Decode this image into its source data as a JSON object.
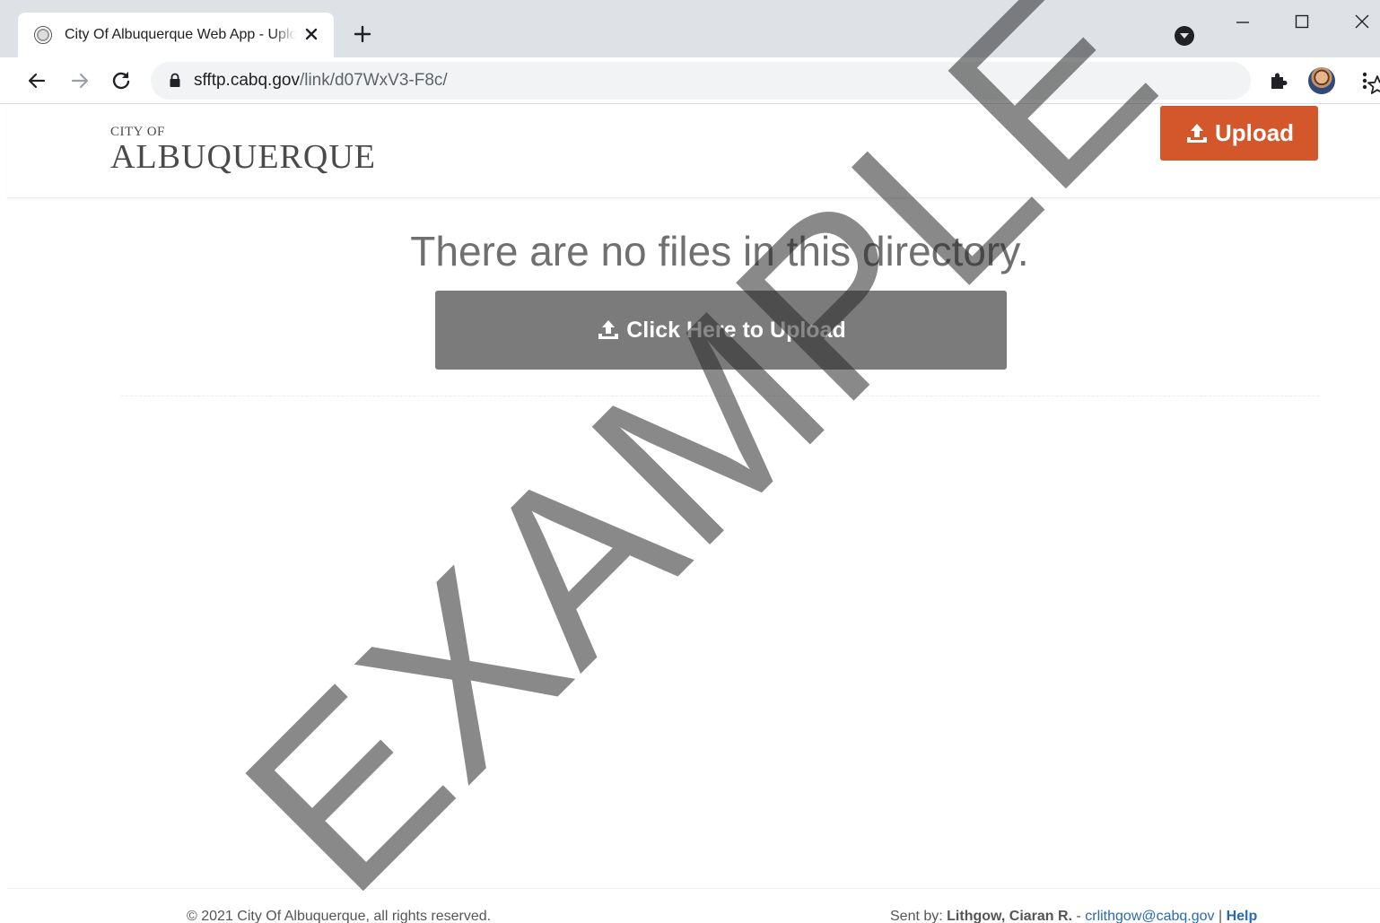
{
  "browser": {
    "tab_title": "City Of Albuquerque Web App - Upload",
    "url_host": "sfftp.cabq.gov",
    "url_path": "/link/d07WxV3-F8c/"
  },
  "header": {
    "logo_small": "CITY OF",
    "logo_big": "ALBUQUERQUE",
    "upload_label": "Upload"
  },
  "main": {
    "empty_message": "There are no files in this directory.",
    "upload_button_label": "Click Here to Upload",
    "watermark": "EXAMPLE"
  },
  "footer": {
    "copyright": "© 2021 City Of Albuquerque, all rights reserved.",
    "sent_by_prefix": "Sent by: ",
    "sender_name": "Lithgow, Ciaran R.",
    "separator": " - ",
    "sender_email": "crlithgow@cabq.gov",
    "pipe": " | ",
    "help_label": "Help"
  },
  "colors": {
    "upload_button": "#d4572c",
    "big_upload_button": "#7b7b7b",
    "link": "#2a6ab1"
  }
}
